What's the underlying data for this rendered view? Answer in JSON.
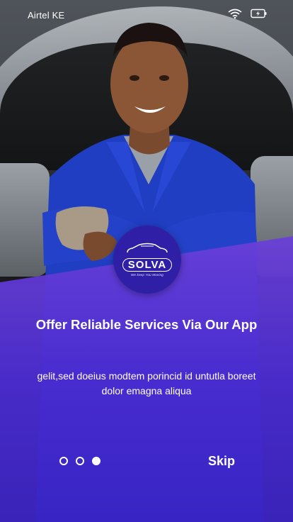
{
  "status_bar": {
    "carrier": "Airtel KE",
    "icons": [
      "wifi-icon",
      "battery-charging-icon"
    ]
  },
  "logo": {
    "name": "SOLVA",
    "tagline": "We keep You Moving"
  },
  "onboarding": {
    "title": "Offer Reliable Services Via Our App",
    "description": "gelit,sed doeius modtem porincid id untutla boreet dolor emagna aliqua",
    "pages": 3,
    "active_page": 3,
    "skip_label": "Skip"
  },
  "colors": {
    "panel_top": "#6b3fd8",
    "panel_bottom": "#3a22c4",
    "logo_badge": "#2e1fa6",
    "text": "#ffffff"
  }
}
